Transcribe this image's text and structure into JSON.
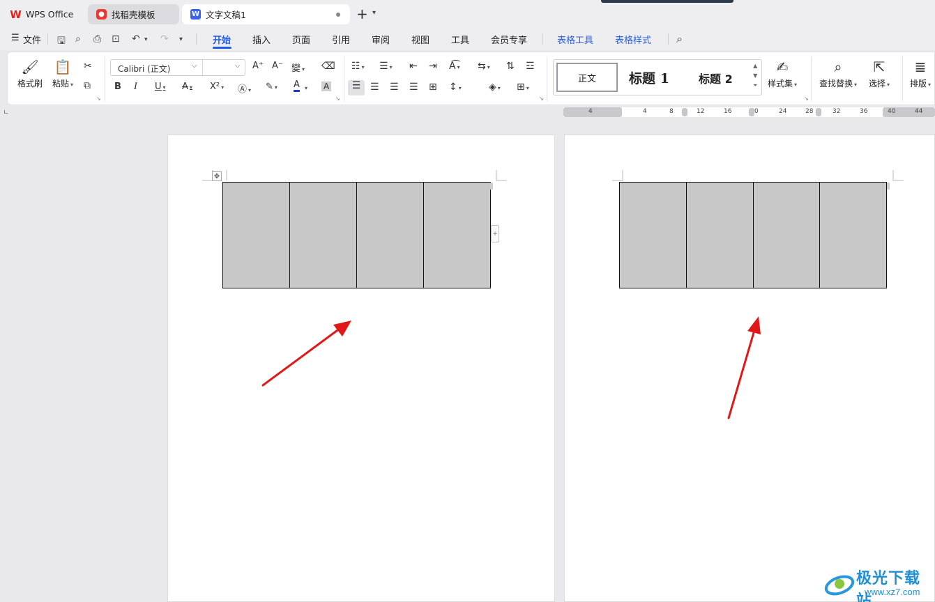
{
  "tabs": [
    {
      "label": "WPS Office"
    },
    {
      "label": "找稻壳模板"
    },
    {
      "label": "文字文稿1"
    }
  ],
  "menu": {
    "file": "文件",
    "items": [
      "开始",
      "插入",
      "页面",
      "引用",
      "审阅",
      "视图",
      "工具",
      "会员专享"
    ],
    "context_items": [
      "表格工具",
      "表格样式"
    ],
    "active": "开始"
  },
  "ribbon": {
    "format_painter": "格式刷",
    "paste": "粘贴",
    "font_name": "Calibri (正文)",
    "font_size": "",
    "styles": {
      "normal": "正文",
      "heading1": "标题 1",
      "heading2": "标题 2"
    },
    "style_set": "样式集",
    "find_replace": "查找替换",
    "select": "选择",
    "layout": "排版",
    "icons": [
      "format-painter-icon",
      "paste-icon",
      "cut-icon",
      "copy-icon",
      "bold-icon",
      "italic-icon",
      "underline-icon",
      "strikethrough-icon",
      "superscript-icon",
      "text-effect-icon",
      "highlight-icon",
      "font-color-icon",
      "char-shading-icon",
      "grow-font-icon",
      "shrink-font-icon",
      "phonetic-icon",
      "clear-format-icon",
      "bullets-icon",
      "numbering-icon",
      "outdent-icon",
      "indent-icon",
      "text-direction-icon",
      "sort-icon",
      "align-left-icon",
      "align-center-icon",
      "align-right-icon",
      "justify-icon",
      "distribute-icon",
      "line-spacing-icon",
      "shading-icon",
      "borders-icon",
      "search-icon",
      "select-cursor-icon"
    ],
    "font_color": "#1e3bd6"
  },
  "ruler": {
    "numbers": [
      "4",
      "4",
      "8",
      "12",
      "16",
      "0",
      "24",
      "28",
      "32",
      "36",
      "40",
      "44"
    ]
  },
  "document": {
    "table1": {
      "rows": 1,
      "cols": 4
    },
    "table2": {
      "rows": 1,
      "cols": 4
    },
    "cell_fill": "#c8c8c8",
    "arrow_color": "#e01818"
  },
  "watermark": {
    "title": "极光下载站",
    "url": "www.xz7.com"
  }
}
